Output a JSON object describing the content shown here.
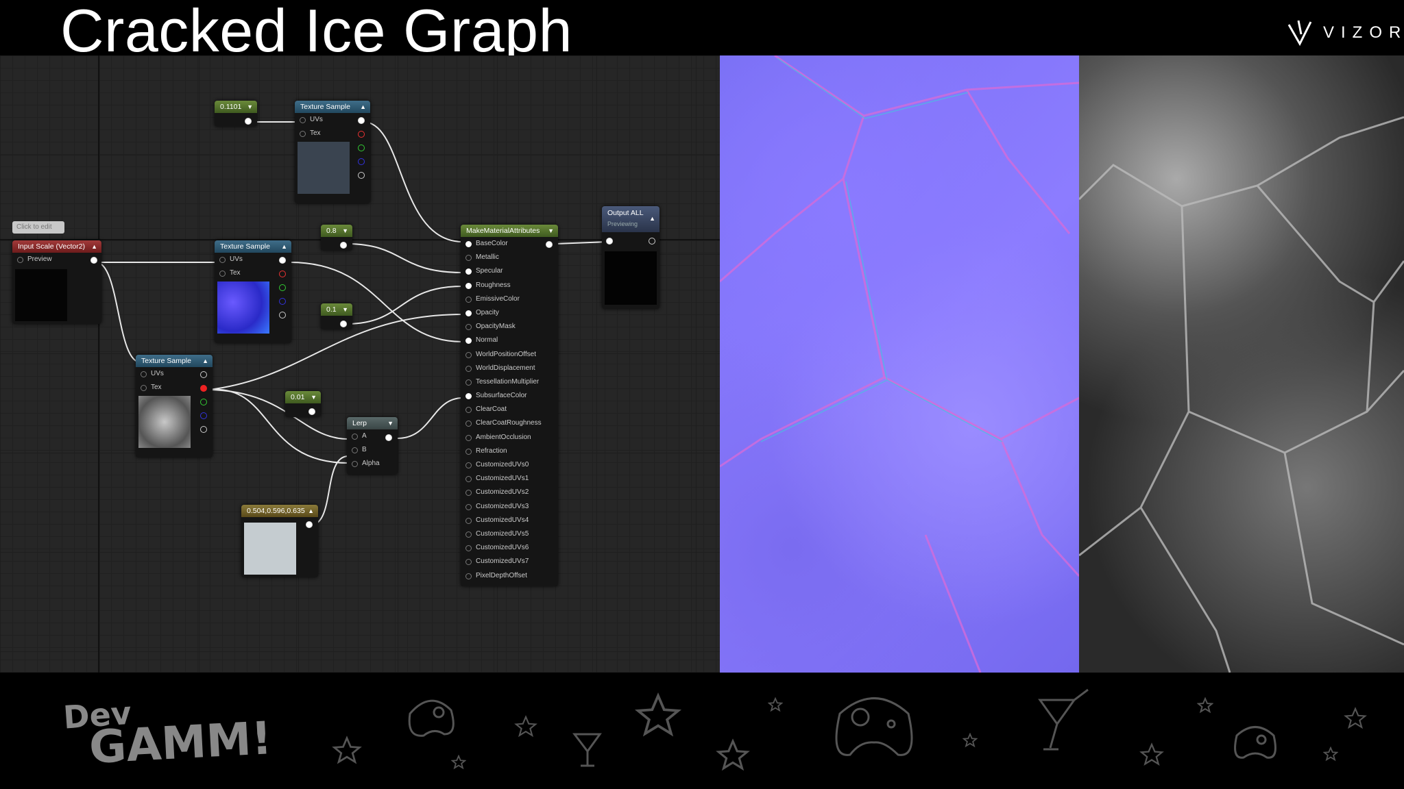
{
  "slide": {
    "title": "Cracked Ice Graph",
    "logo_text": "VIZOR",
    "footer_logo_line1": "Dev",
    "footer_logo_line2": "GAMM!"
  },
  "badge": {
    "label": "Click to edit"
  },
  "nodes": {
    "constant_1": {
      "value": "0.1101"
    },
    "tex_top": {
      "title": "Texture Sample",
      "pin_uvs": "UVs",
      "pin_tex": "Tex"
    },
    "input_scale": {
      "title": "Input Scale (Vector2)",
      "pin_preview": "Preview"
    },
    "tex_mid": {
      "title": "Texture Sample",
      "pin_uvs": "UVs",
      "pin_tex": "Tex"
    },
    "constant_08": {
      "value": "0.8"
    },
    "constant_01": {
      "value": "0.1"
    },
    "tex_bottom": {
      "title": "Texture Sample",
      "pin_uvs": "UVs",
      "pin_tex": "Tex"
    },
    "constant_001": {
      "value": "0.01"
    },
    "lerp": {
      "title": "Lerp",
      "pin_a": "A",
      "pin_b": "B",
      "pin_alpha": "Alpha"
    },
    "color_const": {
      "value": "0.504,0.596,0.635"
    },
    "make_material": {
      "title": "MakeMaterialAttributes",
      "pins": [
        "BaseColor",
        "Metallic",
        "Specular",
        "Roughness",
        "EmissiveColor",
        "Opacity",
        "OpacityMask",
        "Normal",
        "WorldPositionOffset",
        "WorldDisplacement",
        "TessellationMultiplier",
        "SubsurfaceColor",
        "ClearCoat",
        "ClearCoatRoughness",
        "AmbientOcclusion",
        "Refraction",
        "CustomizedUVs0",
        "CustomizedUVs1",
        "CustomizedUVs2",
        "CustomizedUVs3",
        "CustomizedUVs4",
        "CustomizedUVs5",
        "CustomizedUVs6",
        "CustomizedUVs7",
        "PixelDepthOffset"
      ]
    },
    "output": {
      "title": "Output ALL",
      "subtitle": "Previewing"
    }
  },
  "colors": {
    "normal_map": "#7b70f4",
    "height_map": "#2a2a2a",
    "accent_teal": "#3f6d89"
  },
  "icons": [
    "vizor-logo-icon",
    "gamepad-icon",
    "star-icon",
    "cocktail-icon"
  ]
}
